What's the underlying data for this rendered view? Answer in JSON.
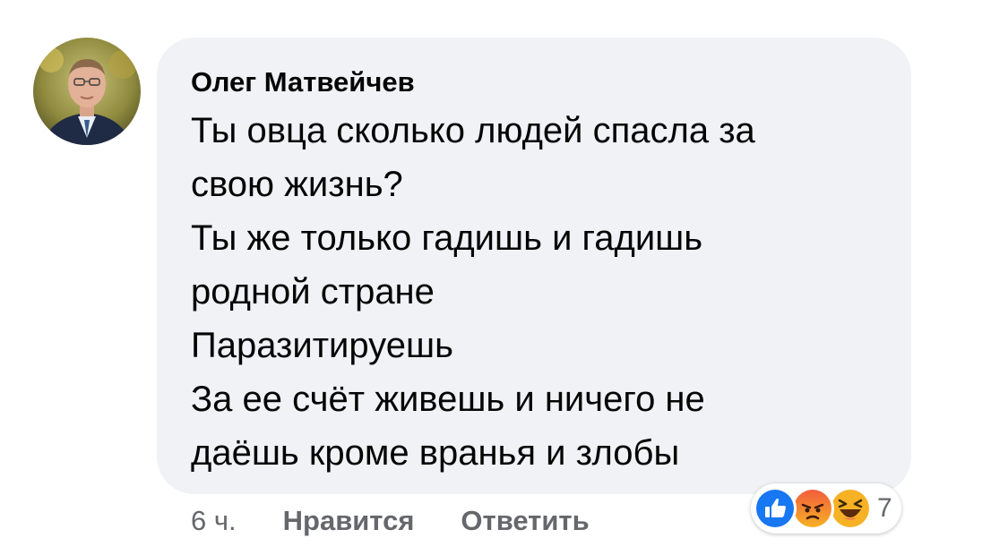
{
  "comment": {
    "author": "Олег Матвейчев",
    "lines": [
      "Ты овца сколько людей спасла за",
      "свою жизнь?",
      "Ты же только гадишь и гадишь",
      "родной стране",
      "Паразитируешь",
      "За ее счёт живешь и ничего не",
      "даёшь кроме вранья и злобы"
    ],
    "time": "6 ч.",
    "like_label": "Нравится",
    "reply_label": "Ответить",
    "reactions": {
      "icons": [
        "like-icon",
        "angry-icon",
        "haha-icon"
      ],
      "count": "7"
    }
  },
  "colors": {
    "bubble": "#f0f2f5",
    "text": "#050505",
    "secondary_text": "#65676b",
    "like_blue": "#1877f2",
    "angry_orange": "#e9710f",
    "haha_yellow": "#f7b125"
  }
}
